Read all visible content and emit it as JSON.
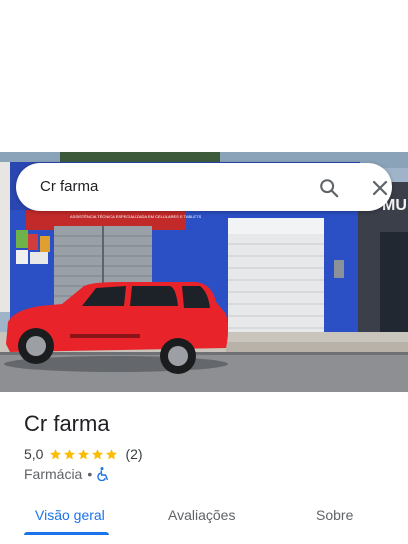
{
  "search": {
    "query": "Cr farma"
  },
  "place": {
    "name": "Cr farma",
    "rating": "5,0",
    "review_count": "(2)",
    "stars": 5,
    "category": "Farmácia",
    "separator": "•"
  },
  "hero_sign": {
    "store_sign_text": "ASSISTÊNCIA TÉCNICA ESPECIALIZADA EM CELULARES E TABLETS",
    "side_sign_text": "MU"
  },
  "tabs": [
    {
      "label": "Visão geral",
      "active": true
    },
    {
      "label": "Avaliações",
      "active": false
    },
    {
      "label": "Sobre",
      "active": false
    }
  ],
  "colors": {
    "accent": "#1a73e8",
    "star": "#fbbc04",
    "car": "#e8242a",
    "wall": "#2b4fc4"
  }
}
